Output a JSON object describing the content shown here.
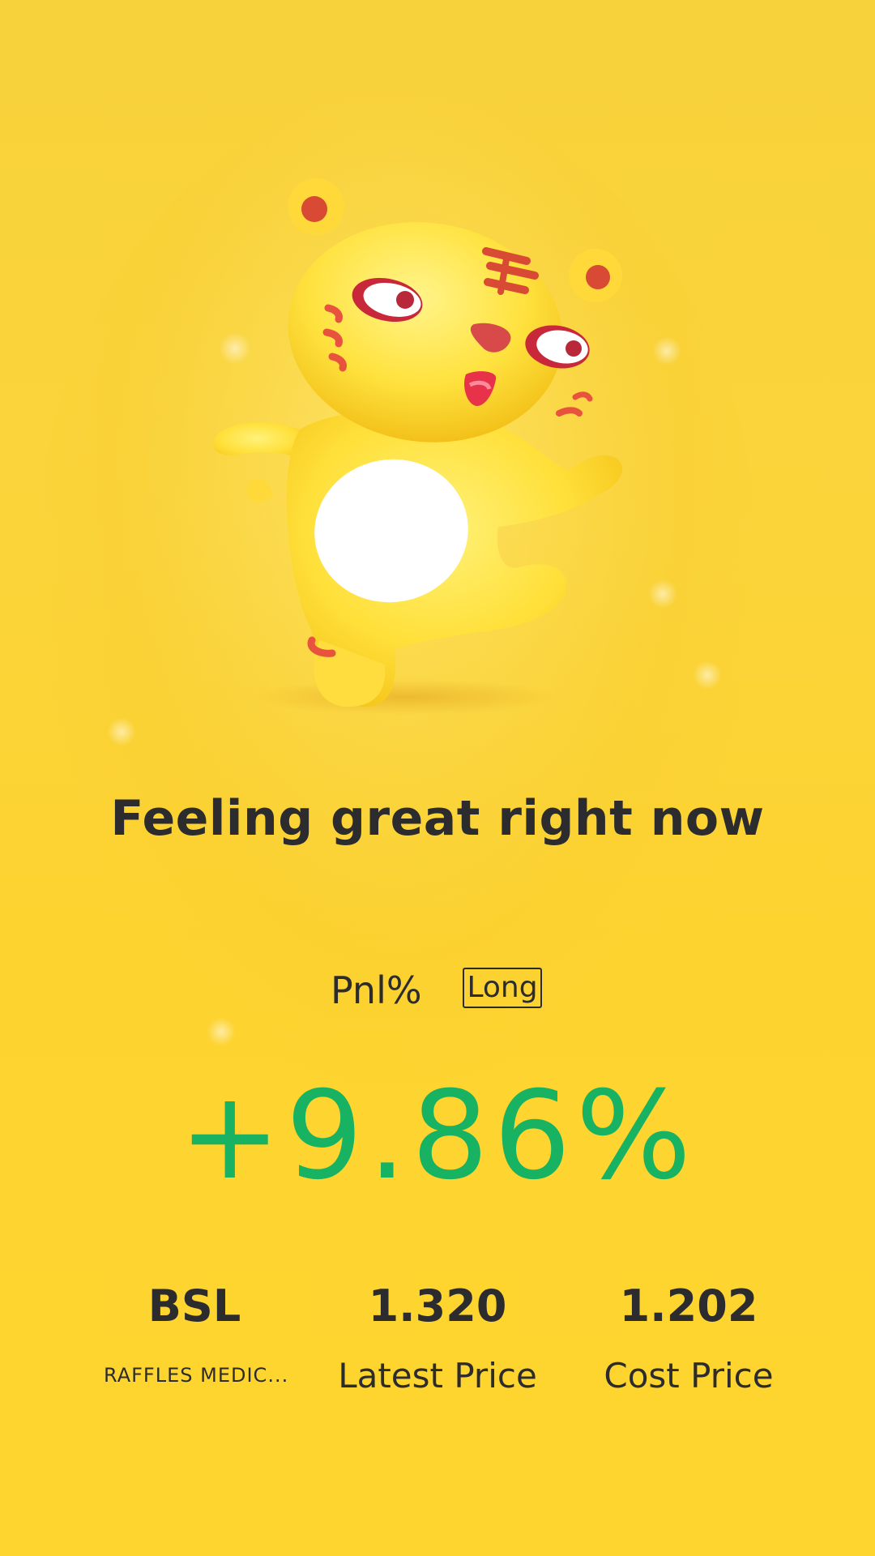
{
  "headline": "Feeling great right now",
  "pnl": {
    "label": "Pnl%",
    "badge": "Long",
    "value": "+9.86%",
    "value_color": "#17b262"
  },
  "stats": {
    "symbol": "BSL",
    "name": "RAFFLES MEDIC...",
    "latest_price": "1.320",
    "latest_price_label": "Latest Price",
    "cost_price": "1.202",
    "cost_price_label": "Cost Price"
  },
  "mascot": {
    "icon": "dancing-tiger-mascot"
  },
  "colors": {
    "background": "#fcd12d",
    "text": "#2c2c2e",
    "gain": "#17b262"
  }
}
